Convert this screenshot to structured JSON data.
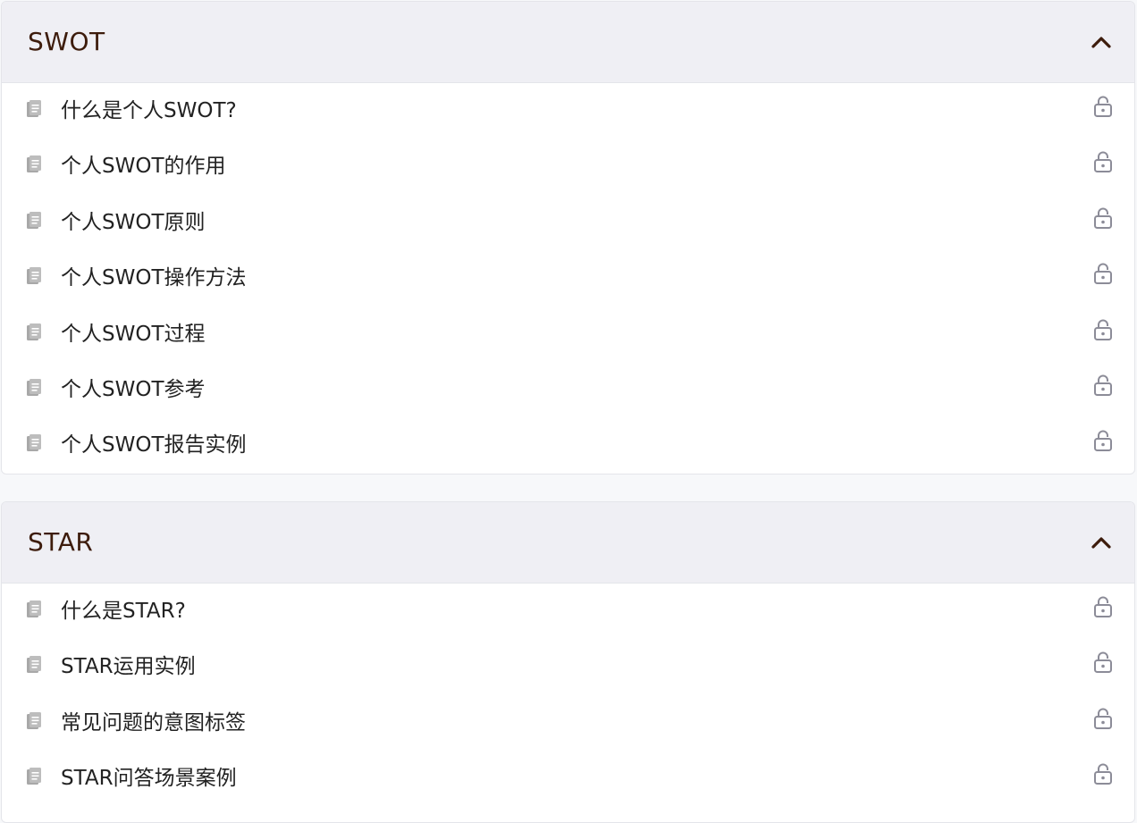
{
  "sections": [
    {
      "title": "SWOT",
      "expanded": true,
      "items": [
        {
          "label": "什么是个人SWOT?",
          "locked": true
        },
        {
          "label": "个人SWOT的作用",
          "locked": true
        },
        {
          "label": "个人SWOT原则",
          "locked": true
        },
        {
          "label": "个人SWOT操作方法",
          "locked": true
        },
        {
          "label": "个人SWOT过程",
          "locked": true
        },
        {
          "label": "个人SWOT参考",
          "locked": true
        },
        {
          "label": "个人SWOT报告实例",
          "locked": true
        }
      ]
    },
    {
      "title": "STAR",
      "expanded": true,
      "items": [
        {
          "label": "什么是STAR?",
          "locked": true
        },
        {
          "label": "STAR运用实例",
          "locked": true
        },
        {
          "label": "常见问题的意图标签",
          "locked": true
        },
        {
          "label": "STAR问答场景案例",
          "locked": true
        }
      ]
    }
  ],
  "icons": {
    "item": "document-icon",
    "status": "lock-icon",
    "toggle": "chevron-up-icon"
  },
  "colors": {
    "header_bg": "#efeff4",
    "title": "#3d1c0c",
    "item_text": "#222222",
    "icon_gray": "#9a9a9a",
    "lock_gray": "#8c8c98"
  }
}
